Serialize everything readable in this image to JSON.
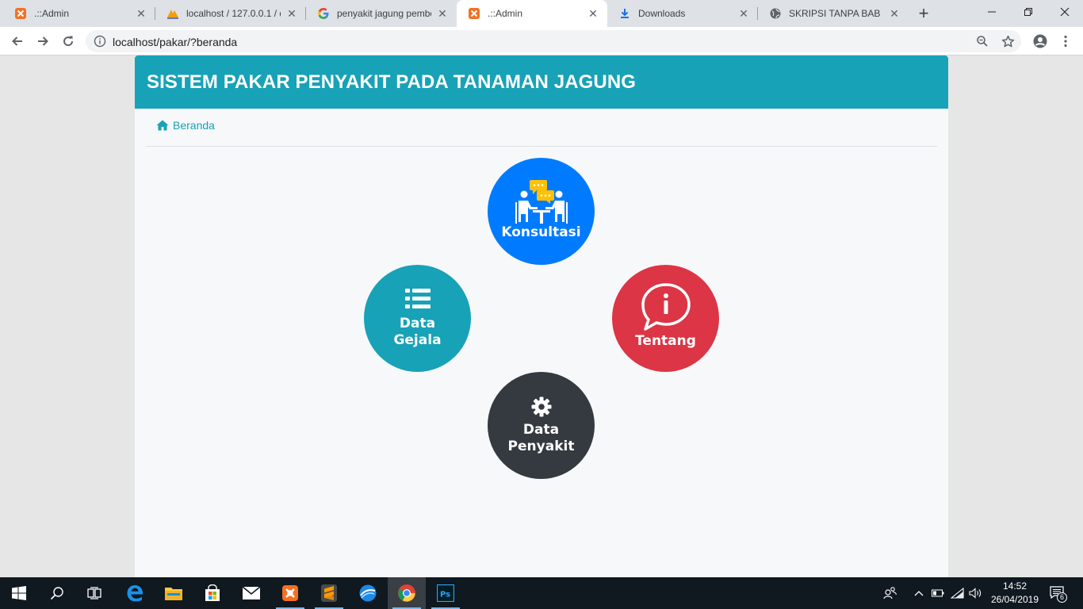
{
  "browser": {
    "tabs": [
      {
        "title": ".::Admin",
        "favicon": "xampp-icon",
        "active": false
      },
      {
        "title": "localhost / 127.0.0.1 / d",
        "favicon": "phpmyadmin-icon",
        "active": false
      },
      {
        "title": "penyakit jagung pembe",
        "favicon": "google-icon",
        "active": false
      },
      {
        "title": ".::Admin",
        "favicon": "xampp-icon",
        "active": true
      },
      {
        "title": "Downloads",
        "favicon": "download-icon",
        "active": false
      },
      {
        "title": "SKRIPSI TANPA BAB PEI",
        "favicon": "globe-icon",
        "active": false
      }
    ],
    "url": "localhost/pakar/?beranda"
  },
  "page": {
    "header_title": "SISTEM PAKAR PENYAKIT PADA TANAMAN JAGUNG",
    "breadcrumb": "Beranda",
    "menu": {
      "konsultasi": "Konsultasi",
      "data_gejala_line1": "Data",
      "data_gejala_line2": "Gejala",
      "tentang": "Tentang",
      "data_penyakit_line1": "Data",
      "data_penyakit_line2": "Penyakit"
    }
  },
  "taskbar": {
    "time": "14:52",
    "date": "26/04/2019",
    "notifications": "6"
  },
  "colors": {
    "header": "#17a2b8",
    "konsultasi": "#007bff",
    "gejala": "#17a2b8",
    "tentang": "#dc3545",
    "penyakit": "#343a40"
  }
}
